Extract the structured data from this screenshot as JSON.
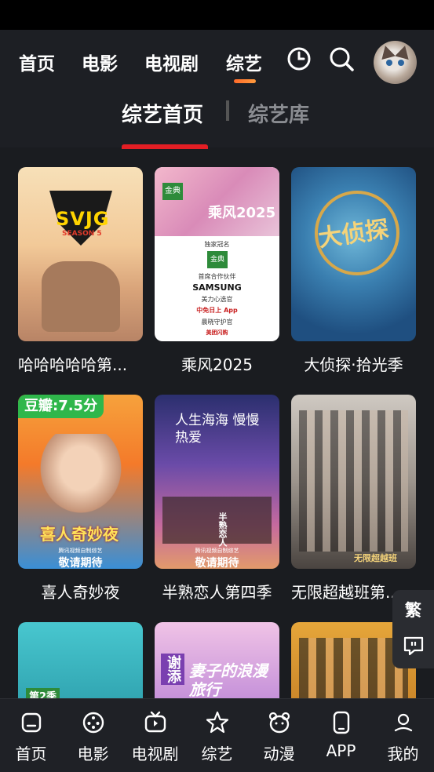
{
  "topnav": {
    "tabs": [
      "首页",
      "电影",
      "电视剧",
      "综艺"
    ],
    "active_tab": "综艺",
    "history_icon": "clock-icon",
    "search_icon": "search-icon",
    "avatar": "avatar-cat"
  },
  "subtabs": [
    "综艺首页",
    "综艺库"
  ],
  "active_subtab": "综艺首页",
  "cards": [
    {
      "title": "哈哈哈哈哈第...",
      "poster_text": "SVJG",
      "poster_sub": "SEASON 5"
    },
    {
      "title": "乘风2025",
      "poster_text": "乘风2025",
      "poster_sub1": "独家冠名",
      "poster_sub2": "金典",
      "poster_sub3": "首席合作伙伴",
      "poster_sub4": "SAMSUNG",
      "poster_sub5": "美力心选官",
      "poster_sub6": "中免日上 App",
      "poster_sub7": "晨晓守护官",
      "poster_sub8": "美团闪购",
      "poster_logo": "金典"
    },
    {
      "title": "大侦探·拾光季",
      "poster_text": "大侦探"
    },
    {
      "title": "喜人奇妙夜",
      "badge": "豆瓣:7.5分",
      "poster_text": "喜人奇妙夜",
      "poster_sub": "敬请期待",
      "poster_sub2": "腾讯视频自制综艺"
    },
    {
      "title": "半熟恋人第四季",
      "poster_text": "人生海海 慢慢热爱",
      "poster_sub": "敬请期待",
      "poster_sub2": "腾讯视频自制综艺",
      "poster_sub3": "半熟恋人"
    },
    {
      "title": "无限超越班第...",
      "poster_text": "无限超越班"
    },
    {
      "title": "",
      "poster_text": "第2季"
    },
    {
      "title": "",
      "poster_text": "妻子的浪漫旅行",
      "poster_sub": "谢添"
    },
    {
      "title": ""
    }
  ],
  "side": {
    "traditional": "繁",
    "feedback_icon": "feedback-icon"
  },
  "bottomnav": [
    {
      "label": "首页",
      "icon": "home-icon"
    },
    {
      "label": "电影",
      "icon": "film-reel-icon"
    },
    {
      "label": "电视剧",
      "icon": "tv-icon"
    },
    {
      "label": "综艺",
      "icon": "star-icon"
    },
    {
      "label": "动漫",
      "icon": "bear-icon"
    },
    {
      "label": "APP",
      "icon": "phone-icon"
    },
    {
      "label": "我的",
      "icon": "user-icon"
    }
  ]
}
